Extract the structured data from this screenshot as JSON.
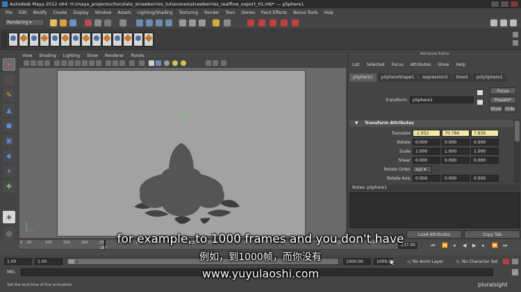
{
  "window": {
    "title": "Autodesk Maya 2012 x64: H:\\maya_projects\\chocolate_strawberries_tut\\scenes\\strawberries_realflow_export_01.mb*   ---   pSphere1"
  },
  "menu": [
    "File",
    "Edit",
    "Modify",
    "Create",
    "Display",
    "Window",
    "Assets",
    "Lighting/Shading",
    "Texturing",
    "Render",
    "Toon",
    "Stereo",
    "Paint Effects",
    "Bonus Tools",
    "Help"
  ],
  "status_line": {
    "mode": "Rendering"
  },
  "viewport": {
    "menu": [
      "View",
      "Shading",
      "Lighting",
      "Show",
      "Renderer",
      "Panels"
    ]
  },
  "attribute_editor": {
    "title": "Attribute Editor",
    "menu": [
      "List",
      "Selected",
      "Focus",
      "Attributes",
      "Show",
      "Help"
    ],
    "tabs": [
      "pSphere1",
      "pSphereShape1",
      "expression3",
      "time1",
      "polySphere1"
    ],
    "transform_label": "transform:",
    "transform_value": "pSphere1",
    "focus_label": "Focus",
    "presets_label": "Presets*",
    "show_label": "Show",
    "hide_label": "Hide",
    "section_title": "Transform Attributes",
    "translate": {
      "label": "Translate",
      "x": "-1.952",
      "y": "70.784",
      "z": "7.836"
    },
    "rotate": {
      "label": "Rotate",
      "x": "0.000",
      "y": "0.000",
      "z": "0.000"
    },
    "scale": {
      "label": "Scale",
      "x": "1.000",
      "y": "1.000",
      "z": "1.000"
    },
    "shear": {
      "label": "Shear",
      "x": "0.000",
      "y": "0.000",
      "z": "0.000"
    },
    "rotate_order": {
      "label": "Rotate Order",
      "value": "xyz"
    },
    "rotate_axis": {
      "label": "Rotate Axis",
      "x": "0.000",
      "y": "0.000",
      "z": "0.000"
    },
    "notes_label": "Notes:  pSphere1",
    "load_attributes": "Load Attributes",
    "copy_tab": "Copy Tab"
  },
  "time_slider": {
    "ticks": [
      "0",
      "50",
      "100",
      "150",
      "200",
      "250",
      "300",
      "350",
      "400",
      "450",
      "500",
      "550",
      "600",
      "650",
      "700",
      "750",
      "800",
      "850",
      "900",
      "950",
      "1000"
    ],
    "marker": "237",
    "current": "237.00"
  },
  "range_slider": {
    "start": "1.00",
    "playback_start": "1.00",
    "handle_label": "1",
    "playback_end": "1000.00",
    "end": "1000.00",
    "anim_layer": "No Anim Layer",
    "character_set": "No Character Set"
  },
  "command_line": {
    "label": "MEL"
  },
  "help_line": {
    "text": "Set the end time of the animation"
  },
  "subtitles": {
    "english": "for example, to 1000 frames and you don't have",
    "chinese": "例如，到1000帧，而你没有",
    "url": "www.yuyulaoshi.com"
  },
  "watermark": "pluralsight",
  "colors": {
    "background": "#444444",
    "viewport_bg": "#a2a2a2",
    "highlight_field": "#f2e9a4",
    "object_gray": "#5b5b5b"
  }
}
